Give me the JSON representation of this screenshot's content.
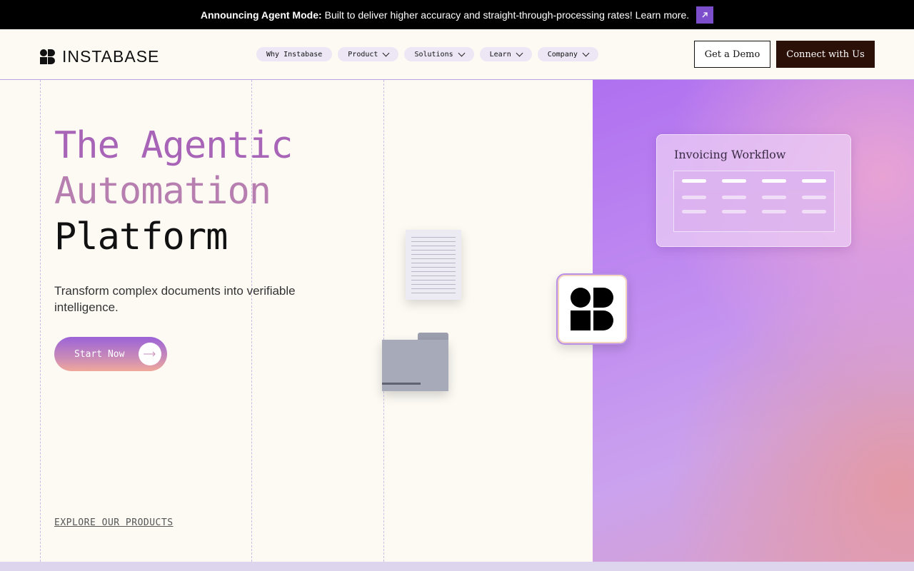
{
  "announcement": {
    "bold": "Announcing Agent Mode:",
    "text": "Built to deliver higher accuracy and straight-through-processing rates! Learn more.",
    "icon": "arrow-up-right-icon"
  },
  "header": {
    "logo_text": "INSTABASE",
    "nav": [
      {
        "label": "Why Instabase",
        "dropdown": false
      },
      {
        "label": "Product",
        "dropdown": true
      },
      {
        "label": "Solutions",
        "dropdown": true
      },
      {
        "label": "Learn",
        "dropdown": true
      },
      {
        "label": "Company",
        "dropdown": true
      }
    ],
    "demo_label": "Get a Demo",
    "connect_label": "Connect with Us"
  },
  "hero": {
    "title_line1": "The Agentic",
    "title_line2": "Automation",
    "title_line3": "Platform",
    "subtitle": "Transform complex documents into verifiable intelligence.",
    "cta_label": "Start Now",
    "explore_label": "EXPLORE OUR PRODUCTS"
  },
  "card": {
    "title": "Invoicing Workflow"
  },
  "colors": {
    "accent": "#7d4ecb",
    "connect_bg": "#2b1008"
  }
}
